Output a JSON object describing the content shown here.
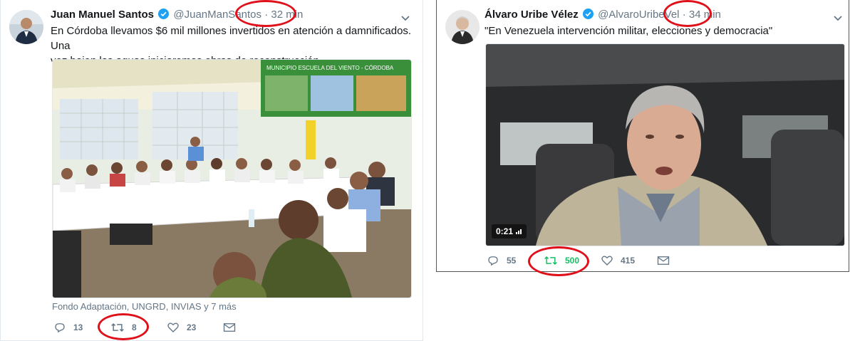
{
  "left_tweet": {
    "author_name": "Juan Manuel Santos",
    "handle": "@JuanManSantos",
    "separator": "·",
    "time": "32 min",
    "text_line1": "En Córdoba llevamos $6 mil millones invertidos en atención a damnificados. Una",
    "text_line2": "vez bajen las aguas iniciaremos obras de reconstrucción",
    "banner_text": "MUNICIPIO ESCUELA DEL VIENTO - CÓRDOBA",
    "tagged": "Fondo Adaptación, UNGRD, INVIAS y 7 más",
    "replies": "13",
    "retweets": "8",
    "likes": "23"
  },
  "right_tweet": {
    "author_name": "Álvaro Uribe Vélez",
    "handle": "@AlvaroUribeVel",
    "separator": "·",
    "time": "34 min",
    "text": "\"En Venezuela intervención militar, elecciones y democracia\"",
    "video_duration": "0:21",
    "replies": "55",
    "retweets": "500",
    "likes": "415"
  },
  "colors": {
    "verified_blue": "#1da1f2",
    "retweet_green": "#17bf63",
    "annotation_red": "#e0101a",
    "secondary_gray": "#657786"
  },
  "icons": [
    "verified-badge-icon",
    "chevron-down-icon",
    "reply-icon",
    "retweet-icon",
    "like-icon",
    "direct-message-icon",
    "video-duration-icon"
  ]
}
